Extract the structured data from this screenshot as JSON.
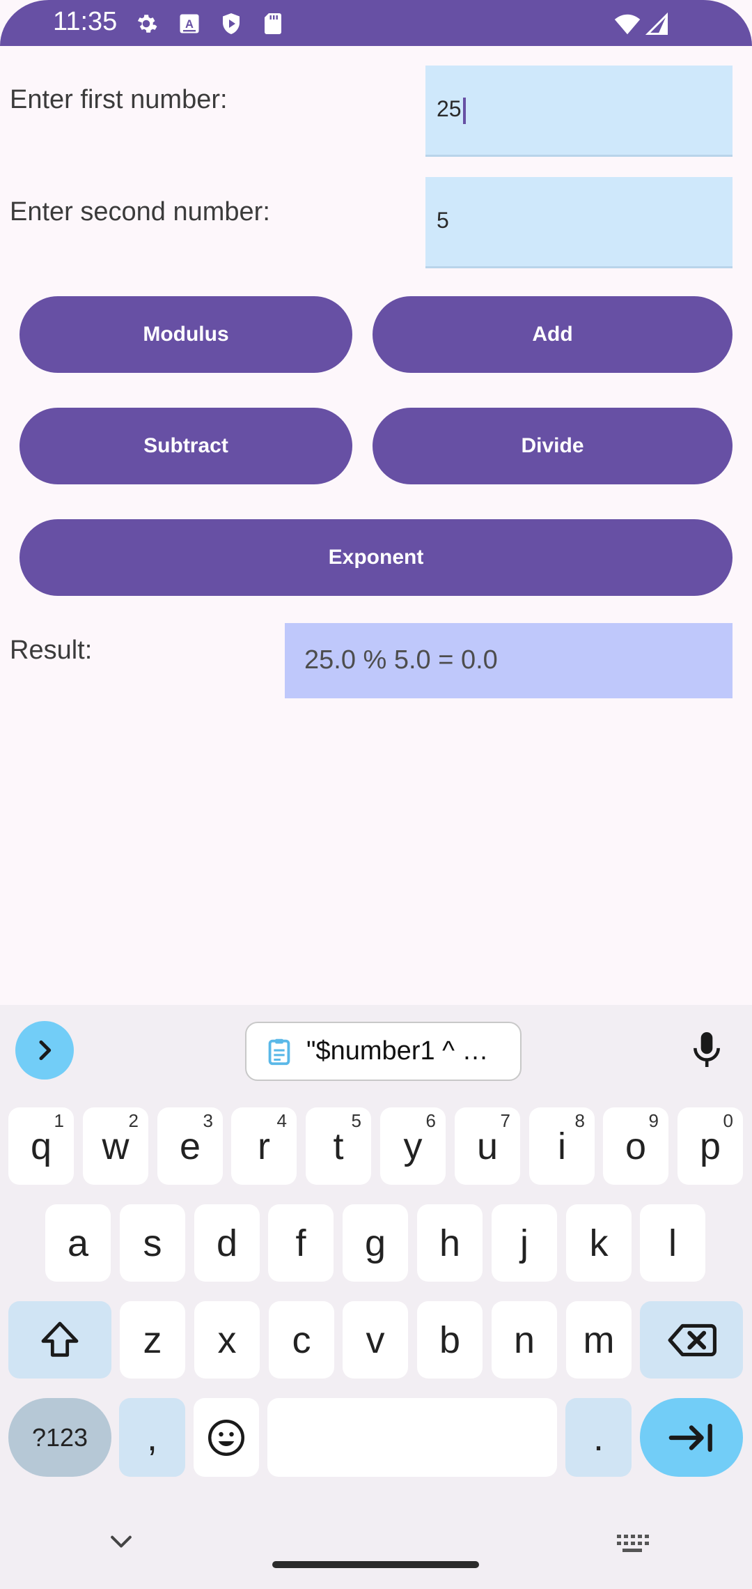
{
  "status_bar": {
    "time": "11:35",
    "left_icons": [
      "gear-icon",
      "keyboard-a-icon",
      "shield-play-icon",
      "sd-card-icon"
    ],
    "right_icons": [
      "wifi-icon",
      "cell-signal-icon"
    ]
  },
  "form": {
    "first_label": "Enter first number:",
    "first_value": "25",
    "second_label": "Enter second number:",
    "second_value": "5"
  },
  "buttons": {
    "modulus": "Modulus",
    "add": "Add",
    "subtract": "Subtract",
    "divide": "Divide",
    "exponent": "Exponent"
  },
  "result": {
    "label": "Result:",
    "value": "25.0 % 5.0 = 0.0"
  },
  "keyboard": {
    "clipboard_chip": "\"$number1 ^ …",
    "row1": [
      {
        "k": "q",
        "h": "1"
      },
      {
        "k": "w",
        "h": "2"
      },
      {
        "k": "e",
        "h": "3"
      },
      {
        "k": "r",
        "h": "4"
      },
      {
        "k": "t",
        "h": "5"
      },
      {
        "k": "y",
        "h": "6"
      },
      {
        "k": "u",
        "h": "7"
      },
      {
        "k": "i",
        "h": "8"
      },
      {
        "k": "o",
        "h": "9"
      },
      {
        "k": "p",
        "h": "0"
      }
    ],
    "row2": [
      "a",
      "s",
      "d",
      "f",
      "g",
      "h",
      "j",
      "k",
      "l"
    ],
    "row3": [
      "z",
      "x",
      "c",
      "v",
      "b",
      "n",
      "m"
    ],
    "symbols_label": "?123",
    "comma": ",",
    "period": "."
  },
  "colors": {
    "primary": "#6750a4",
    "field_bg": "#cfe8fb",
    "result_bg": "#bfc8fb",
    "accent_key": "#72cdf7"
  }
}
